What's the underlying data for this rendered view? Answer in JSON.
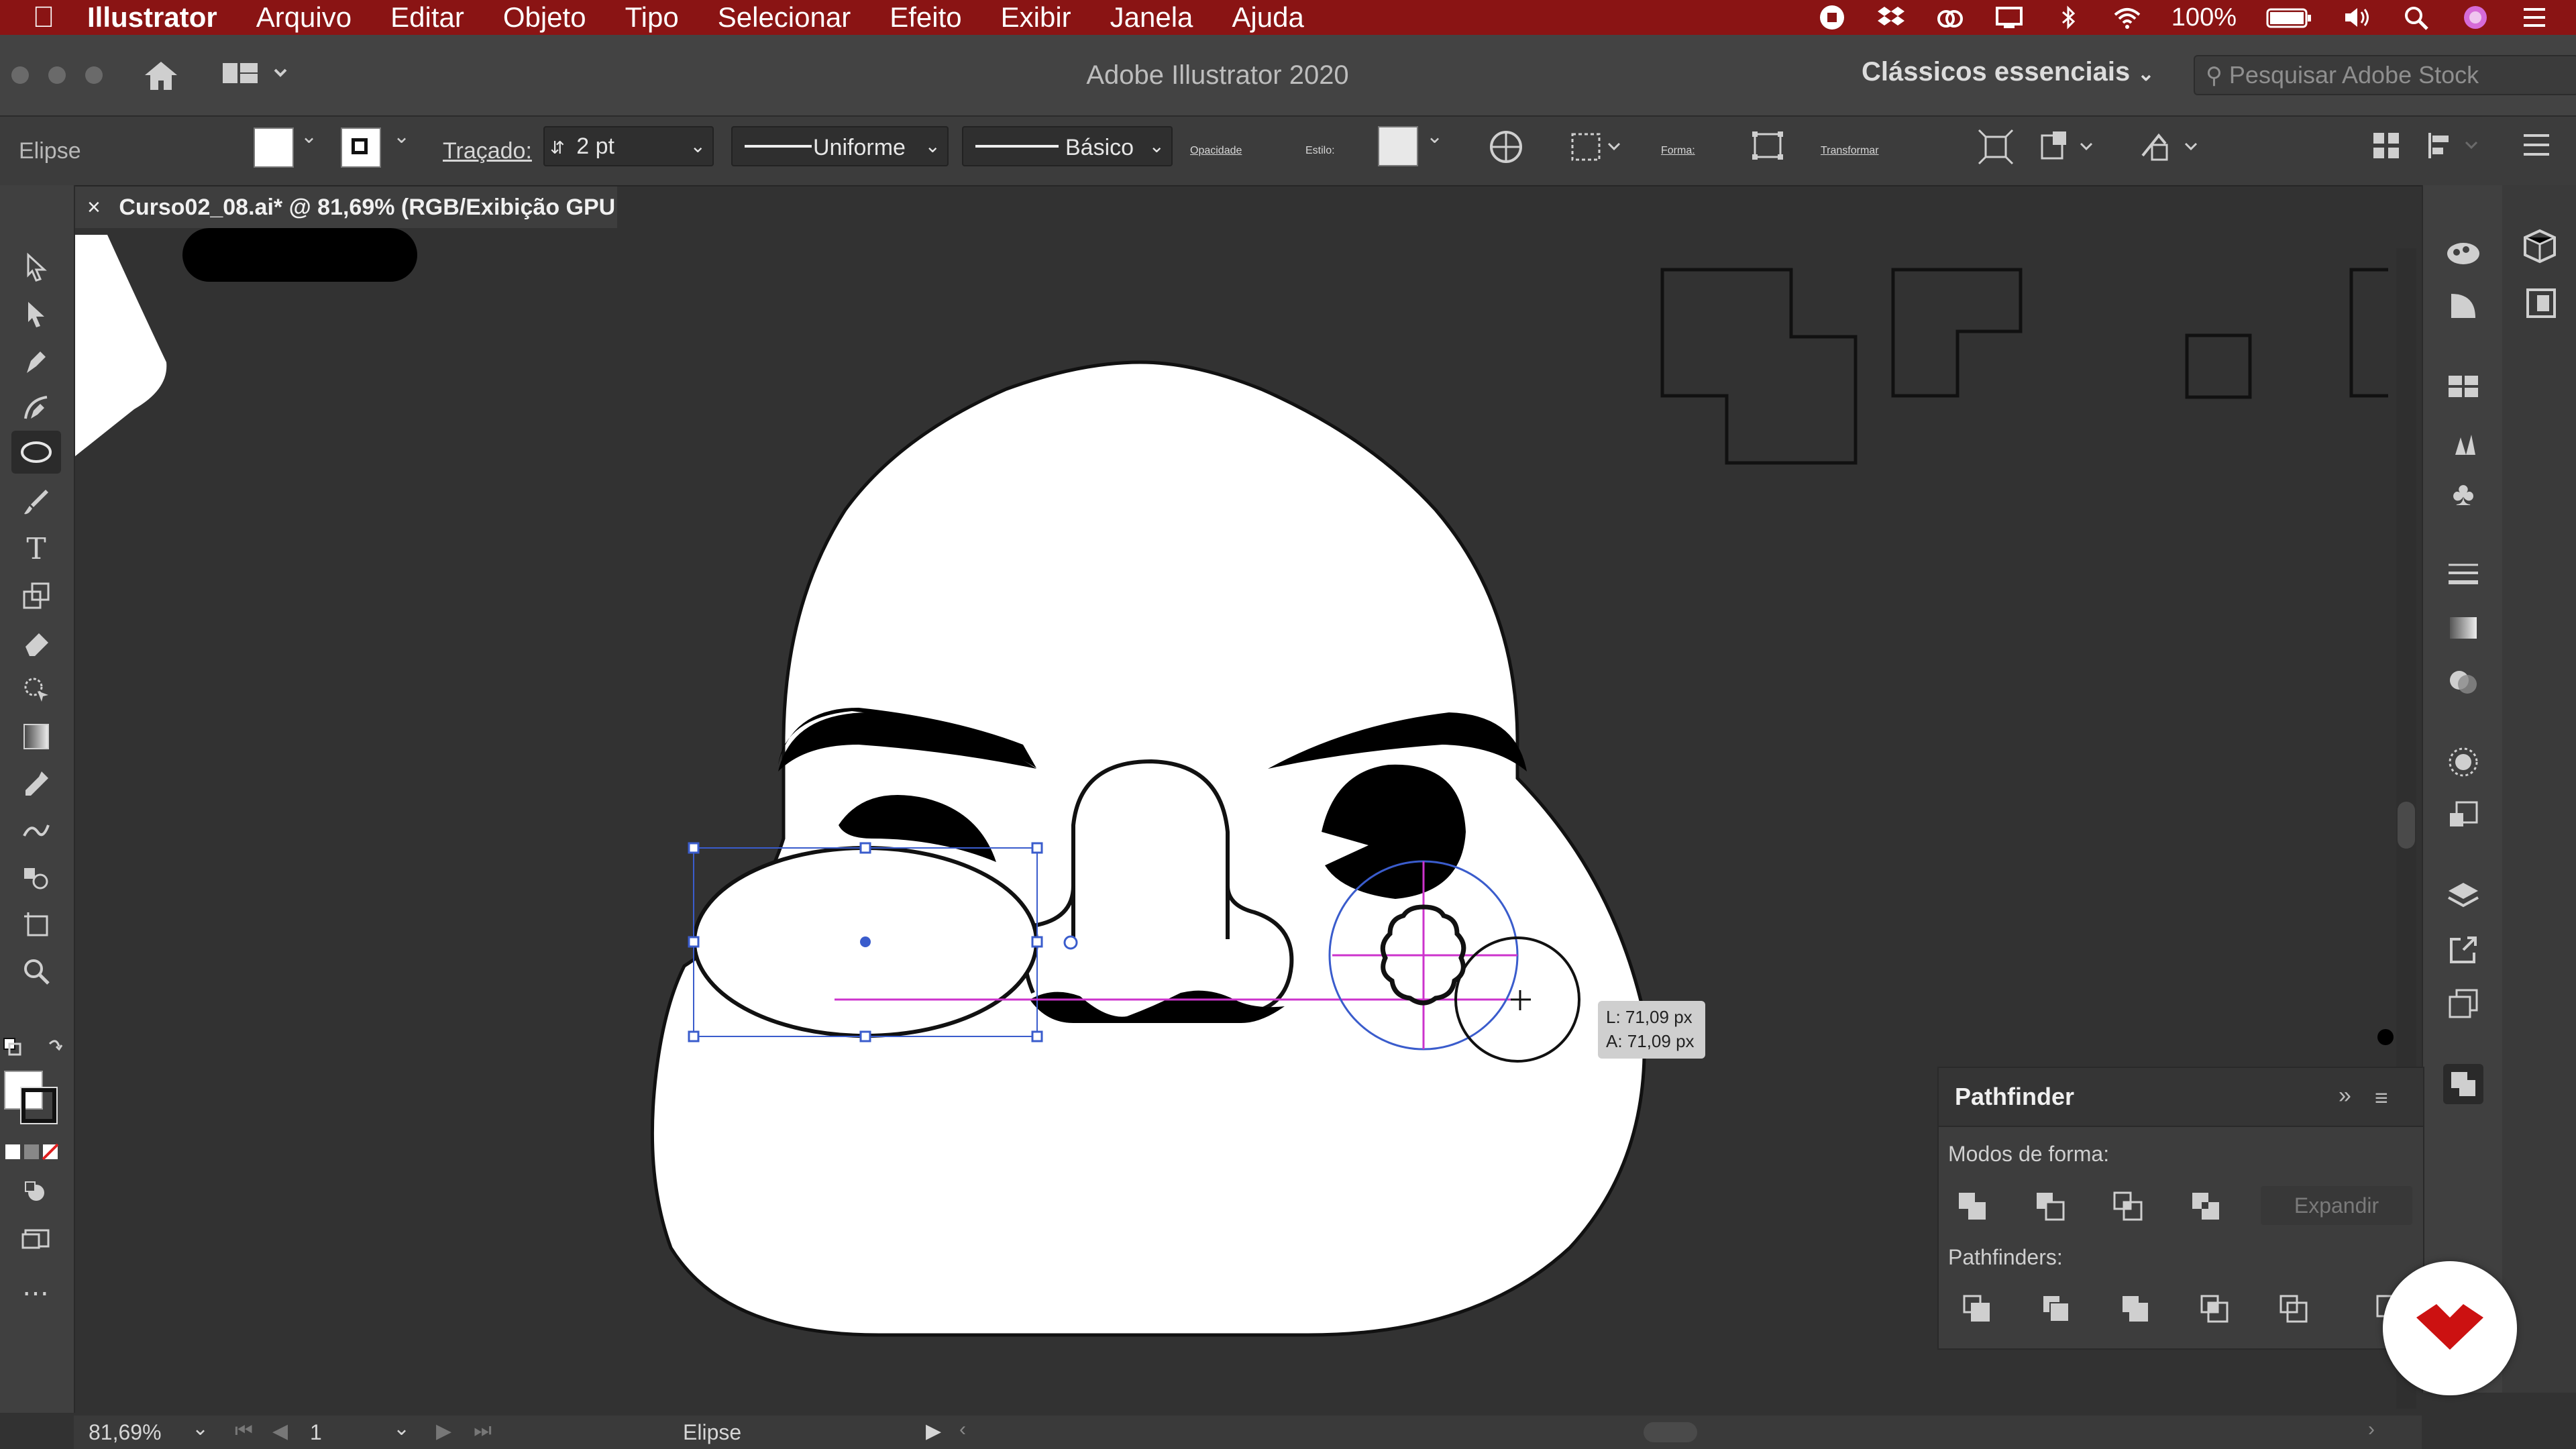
{
  "menubar": {
    "app_name": "Illustrator",
    "items": [
      "Arquivo",
      "Editar",
      "Objeto",
      "Tipo",
      "Selecionar",
      "Efeito",
      "Exibir",
      "Janela",
      "Ajuda"
    ],
    "battery": "100%"
  },
  "appbar": {
    "title": "Adobe Illustrator 2020",
    "workspace": "Clássicos essenciais",
    "search_placeholder": "Pesquisar Adobe Stock"
  },
  "control_bar": {
    "object_type": "Elipse",
    "stroke_label": "Traçado:",
    "stroke_value": "2 pt",
    "profile": "Uniforme",
    "brush": "Básico",
    "opacity_label": "Opacidade",
    "style_label": "Estilo:",
    "shape_label": "Forma:",
    "transform_label": "Transformar"
  },
  "document": {
    "tab_title": "Curso02_08.ai* @ 81,69% (RGB/Exibição GPU )",
    "close_glyph": "×"
  },
  "tooltip": {
    "width": "L: 71,09 px",
    "height": "A: 71,09 px"
  },
  "pathfinder": {
    "title": "Pathfinder",
    "shape_modes_label": "Modos de forma:",
    "expand_label": "Expandir",
    "pathfinders_label": "Pathfinders:"
  },
  "status": {
    "zoom": "81,69%",
    "artboard": "1",
    "selection": "Elipse"
  },
  "colors": {
    "menubar": "#8a1414",
    "selection": "#3a5ccc",
    "smart_guide": "#cc33cc",
    "logo": "#cc1111"
  }
}
